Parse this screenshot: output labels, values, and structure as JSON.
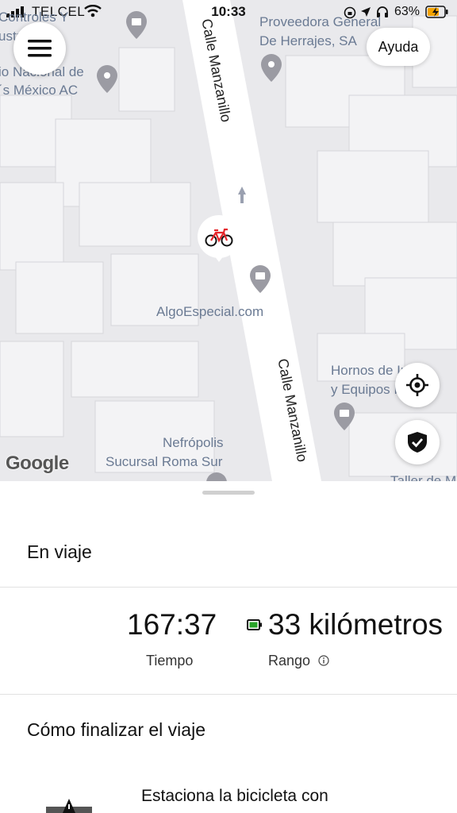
{
  "status_bar": {
    "carrier": "TELCEL",
    "time": "10:33",
    "battery": "63%"
  },
  "map": {
    "labels": {
      "controles": "Controles Y",
      "industriales": "ustriales",
      "proveedora_1": "Proveedora General",
      "proveedora_2": "De Herrajes, SA",
      "nacional_1": "io Nacional de",
      "nacional_2": "´s México AC",
      "algoespecial": "AlgoEspecial.com",
      "hornos_1": "Hornos de Ind",
      "hornos_2": "y Equipos Ind",
      "nefropolis_1": "Nefrópolis",
      "nefropolis_2": "Sucursal Roma Sur",
      "taller": "Taller de M"
    },
    "streets": {
      "upper": "Calle Manzanillo",
      "lower": "Calle Manzanillo"
    },
    "attribution": "Google"
  },
  "header": {
    "help_label": "Ayuda"
  },
  "sheet": {
    "trip_status": "En viaje",
    "time_value": "167:37",
    "time_label": "Tiempo",
    "range_value": "33 kilómetros",
    "range_label": "Rango",
    "end_trip_title": "Cómo finalizar el viaje",
    "step_1": "Estaciona la bicicleta con"
  },
  "colors": {
    "accent_bike": "#e5262b",
    "battery_green": "#29a329",
    "battery_status": "#f2a200"
  },
  "icons": {
    "menu": "hamburger-menu-icon",
    "bike": "bicycle-icon",
    "locate": "crosshair-icon",
    "safety": "shield-check-icon",
    "range_battery": "battery-icon",
    "info": "info-icon",
    "warning": "warning-icon"
  }
}
